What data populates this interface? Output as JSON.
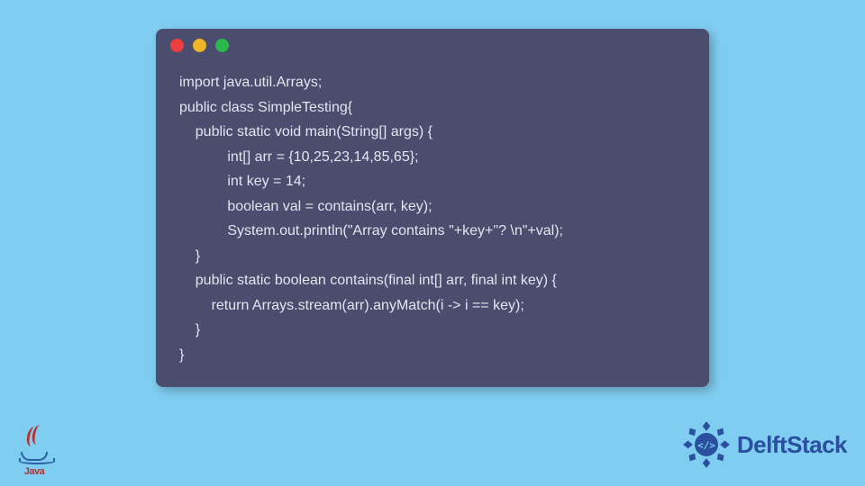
{
  "code": {
    "lines": [
      "import java.util.Arrays;",
      "public class SimpleTesting{",
      "    public static void main(String[] args) {",
      "            int[] arr = {10,25,23,14,85,65};",
      "            int key = 14;",
      "            boolean val = contains(arr, key);",
      "            System.out.println(\"Array contains \"+key+\"? \\n\"+val);",
      "    }",
      "    public static boolean contains(final int[] arr, final int key) {",
      "        return Arrays.stream(arr).anyMatch(i -> i == key);",
      "    }",
      "}"
    ]
  },
  "logos": {
    "java_label": "Java",
    "brand_text": "DelftStack"
  },
  "colors": {
    "background": "#7fcdf0",
    "code_bg": "#4a4d6e",
    "code_fg": "#e4e5ee",
    "brand_blue": "#2a4f9e",
    "java_red": "#b8312f"
  }
}
